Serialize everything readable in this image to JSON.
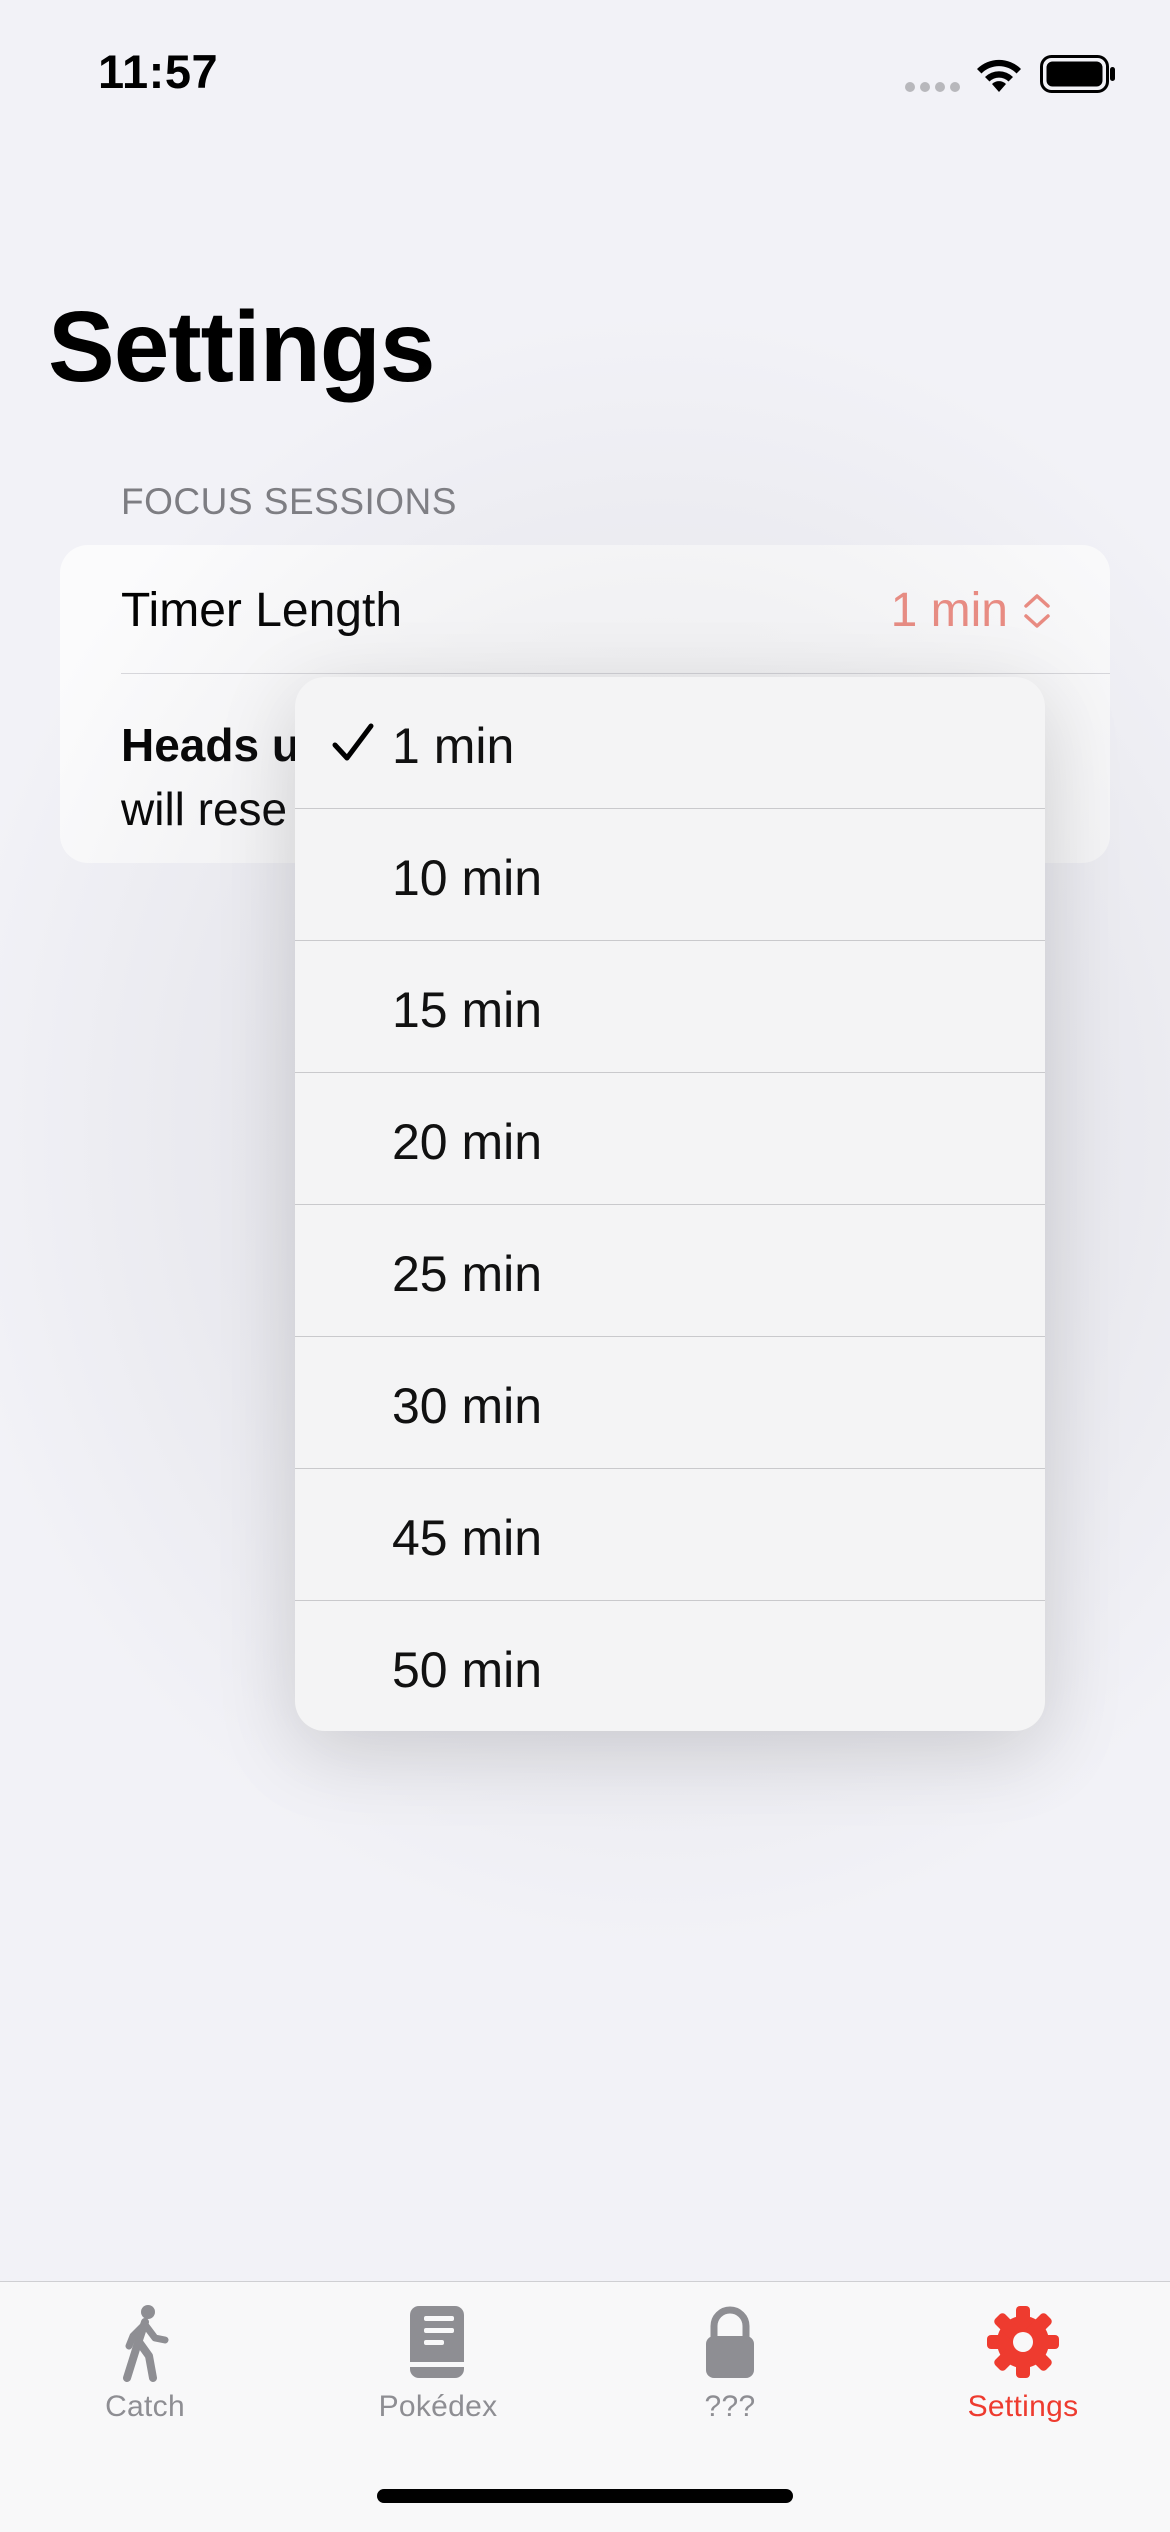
{
  "status_bar": {
    "time": "11:57"
  },
  "page": {
    "title": "Settings"
  },
  "focus_sessions": {
    "header": "FOCUS SESSIONS",
    "timer_length_label": "Timer Length",
    "timer_length_value": "1 min",
    "heads_up_bold": "Heads u",
    "heads_up_text": "will rese"
  },
  "dropdown": {
    "selected_index": 0,
    "items": [
      {
        "label": "1 min"
      },
      {
        "label": "10 min"
      },
      {
        "label": "15 min"
      },
      {
        "label": "20 min"
      },
      {
        "label": "25 min"
      },
      {
        "label": "30 min"
      },
      {
        "label": "45 min"
      },
      {
        "label": "50 min"
      }
    ]
  },
  "tab_bar": {
    "tabs": [
      {
        "label": "Catch",
        "icon": "figure-walk-icon"
      },
      {
        "label": "Pokédex",
        "icon": "book-icon"
      },
      {
        "label": "???",
        "icon": "lock-icon"
      },
      {
        "label": "Settings",
        "icon": "gear-icon"
      }
    ],
    "active_index": 3
  },
  "colors": {
    "accent": "#ee3b2f",
    "value_tint": "#ec8a80",
    "background": "#f2f2f7",
    "inactive_tab": "#8e8e93"
  }
}
